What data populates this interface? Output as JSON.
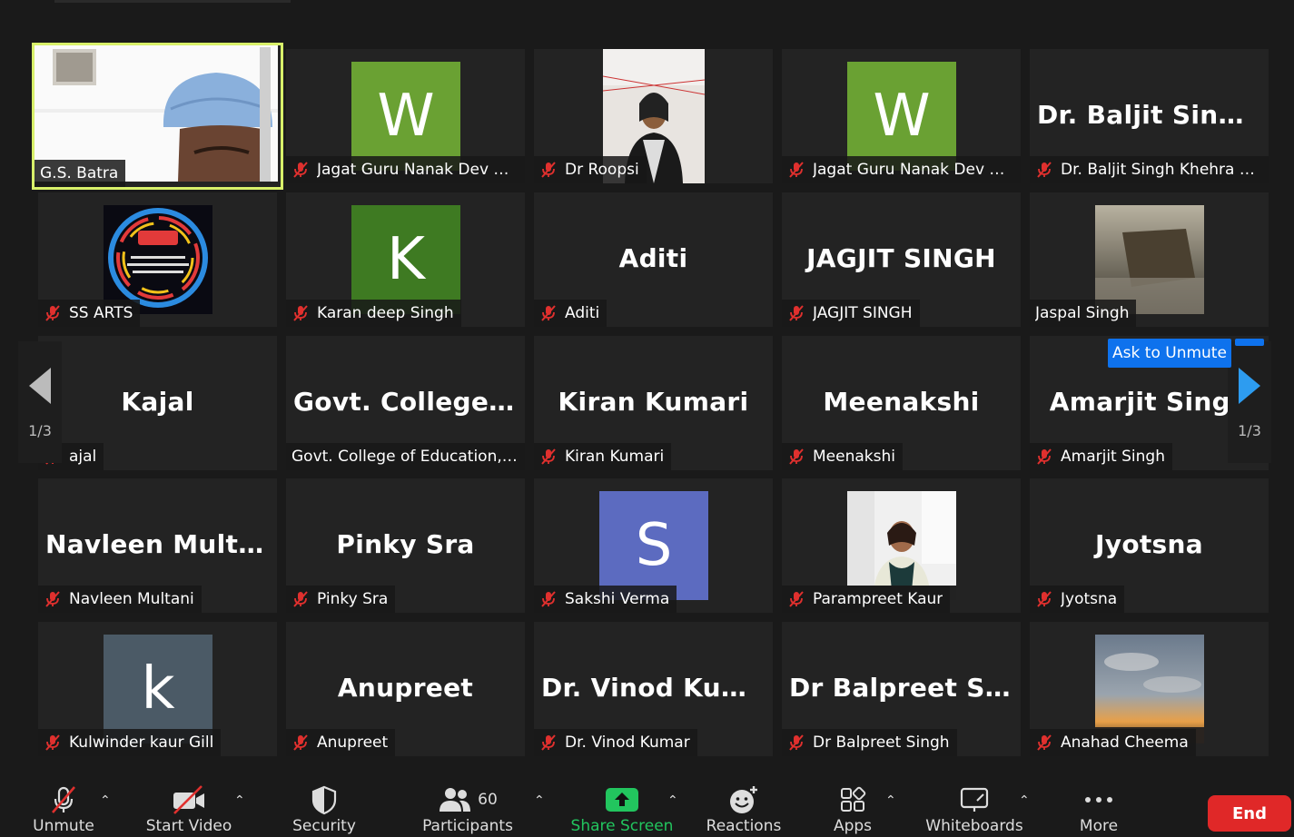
{
  "tiles": [
    {
      "label": "G.S. Batra",
      "muted": false,
      "kind": "video-person"
    },
    {
      "label": "Jagat Guru Nanak Dev Pu...",
      "muted": true,
      "kind": "avatar",
      "initial": "W",
      "color": "#6aa133"
    },
    {
      "label": "Dr Roopsi",
      "muted": true,
      "kind": "photo-woman"
    },
    {
      "label": "Jagat Guru Nanak Dev Pu...",
      "muted": true,
      "kind": "avatar",
      "initial": "W",
      "color": "#6aa133"
    },
    {
      "label": "Dr. Baljit Singh Khehra Di...",
      "muted": true,
      "kind": "name",
      "big": "Dr. Baljit Singh..."
    },
    {
      "label": "SS ARTS",
      "muted": true,
      "kind": "logo-ssarts"
    },
    {
      "label": "Karan deep Singh",
      "muted": true,
      "kind": "avatar",
      "initial": "K",
      "color": "#3e7a22"
    },
    {
      "label": "Aditi",
      "muted": true,
      "kind": "name",
      "big": "Aditi"
    },
    {
      "label": "JAGJIT SINGH",
      "muted": true,
      "kind": "name",
      "big": "JAGJIT SINGH"
    },
    {
      "label": "Jaspal Singh",
      "muted": false,
      "kind": "photo-cliff"
    },
    {
      "label": "ajal",
      "muted": true,
      "kind": "name",
      "big": "Kajal"
    },
    {
      "label": "Govt. College of Education, ...",
      "muted": false,
      "kind": "name",
      "big": "Govt. College o..."
    },
    {
      "label": "Kiran Kumari",
      "muted": true,
      "kind": "name",
      "big": "Kiran Kumari"
    },
    {
      "label": "Meenakshi",
      "muted": true,
      "kind": "name",
      "big": "Meenakshi"
    },
    {
      "label": "Amarjit Singh",
      "muted": true,
      "kind": "name",
      "big": "Amarjit Singh"
    },
    {
      "label": "Navleen Multani",
      "muted": true,
      "kind": "name",
      "big": "Navleen Multani"
    },
    {
      "label": "Pinky Sra",
      "muted": true,
      "kind": "name",
      "big": "Pinky Sra"
    },
    {
      "label": "Sakshi Verma",
      "muted": true,
      "kind": "avatar",
      "initial": "S",
      "color": "#5c6bc0"
    },
    {
      "label": "Parampreet Kaur",
      "muted": true,
      "kind": "photo-office"
    },
    {
      "label": "Jyotsna",
      "muted": true,
      "kind": "name",
      "big": "Jyotsna"
    },
    {
      "label": "Kulwinder kaur Gill",
      "muted": true,
      "kind": "avatar",
      "initial": "k",
      "color": "#4b5a66"
    },
    {
      "label": "Anupreet",
      "muted": true,
      "kind": "name",
      "big": "Anupreet"
    },
    {
      "label": "Dr. Vinod Kumar",
      "muted": true,
      "kind": "name",
      "big": "Dr. Vinod Kumar"
    },
    {
      "label": "Dr Balpreet Singh",
      "muted": true,
      "kind": "name",
      "big": "Dr Balpreet Singh"
    },
    {
      "label": "Anahad Cheema",
      "muted": true,
      "kind": "photo-sunset"
    }
  ],
  "navigation": {
    "page_left": "1/3",
    "page_right": "1/3"
  },
  "ask_to_unmute": "Ask to Unmute",
  "toolbar": {
    "unmute": "Unmute",
    "start_video": "Start Video",
    "security": "Security",
    "participants": "Participants",
    "participants_count": "60",
    "share_screen": "Share Screen",
    "reactions": "Reactions",
    "apps": "Apps",
    "whiteboards": "Whiteboards",
    "more": "More",
    "end": "End"
  },
  "colors": {
    "background": "#1a1a1a",
    "tile": "#232323",
    "active_speaker": "#d8f06a",
    "share_green": "#22c55e",
    "end_red": "#e02828",
    "muted_red": "#e0302e",
    "accent_blue": "#0e72ed"
  }
}
